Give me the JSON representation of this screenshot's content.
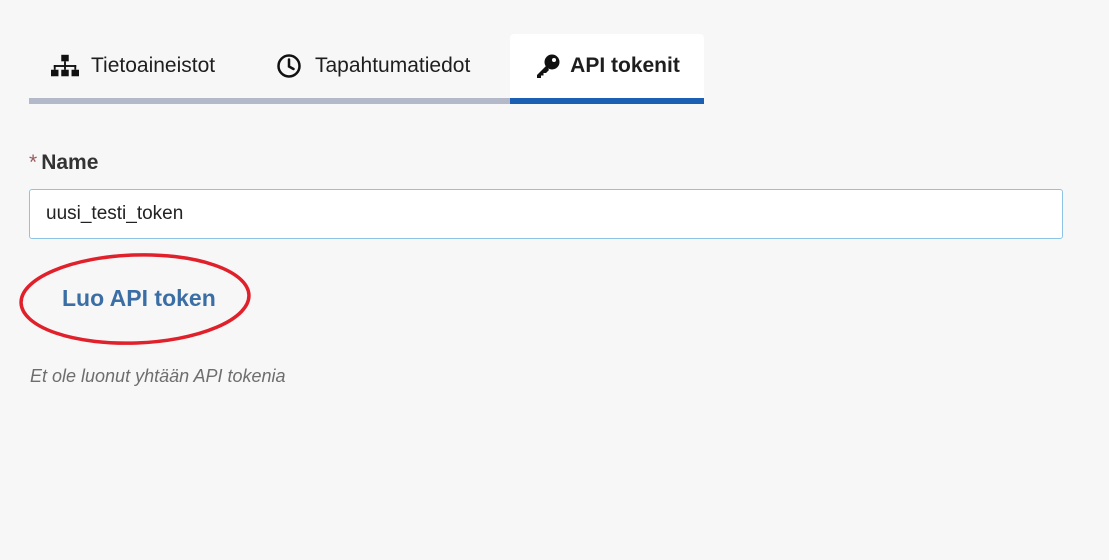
{
  "tabs": {
    "items": [
      {
        "label": "Tietoaineistot",
        "icon": "sitemap-icon"
      },
      {
        "label": "Tapahtumatiedot",
        "icon": "clock-icon"
      },
      {
        "label": "API tokenit",
        "icon": "key-icon",
        "active": true
      }
    ]
  },
  "form": {
    "name_label": "Name",
    "required_marker": "*",
    "name_value": "uusi_testi_token",
    "create_button_label": "Luo API token"
  },
  "tokens": {
    "empty_message": "Et ole luonut yhtään API tokenia"
  },
  "colors": {
    "accent": "#1a5fb4",
    "link": "#3a6ea5",
    "annotation": "#e0202a"
  }
}
